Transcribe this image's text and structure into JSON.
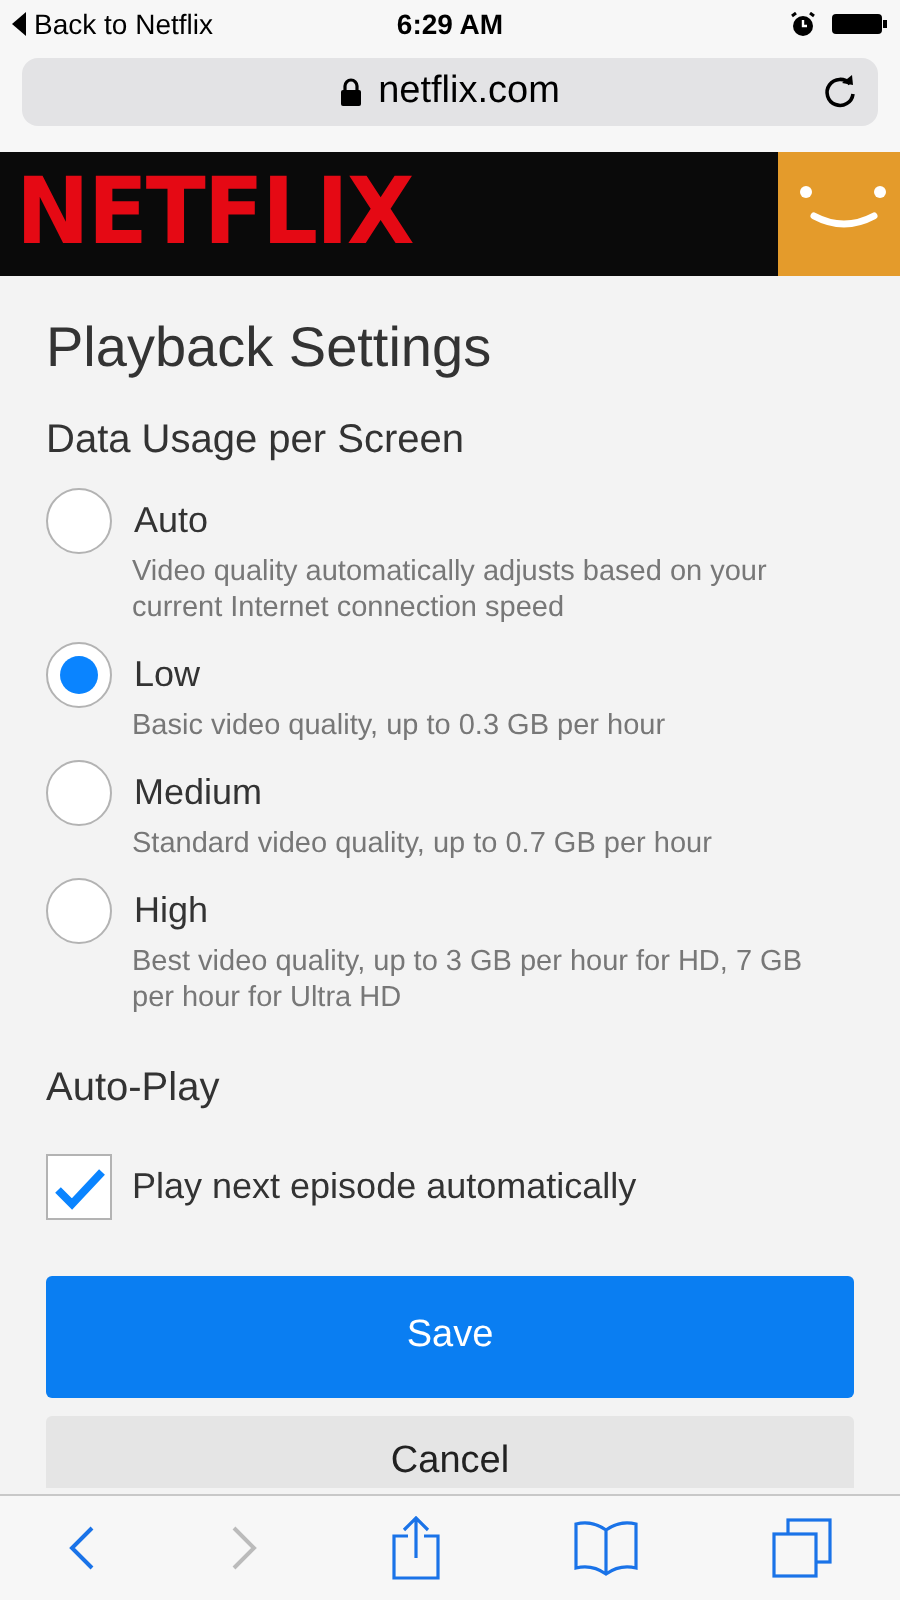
{
  "status_bar": {
    "back_label": "Back to Netflix",
    "time": "6:29 AM"
  },
  "address_bar": {
    "url": "netflix.com"
  },
  "banner": {
    "logo": "NETFLIX"
  },
  "title": "Playback Settings",
  "data_usage": {
    "heading": "Data Usage per Screen",
    "options": [
      {
        "label": "Auto",
        "description": "Video quality automatically adjusts based on your current Internet connection speed",
        "selected": false
      },
      {
        "label": "Low",
        "description": "Basic video quality, up to 0.3 GB per hour",
        "selected": true
      },
      {
        "label": "Medium",
        "description": "Standard video quality, up to 0.7 GB per hour",
        "selected": false
      },
      {
        "label": "High",
        "description": "Best video quality, up to 3 GB per hour for HD, 7 GB per hour for Ultra HD",
        "selected": false
      }
    ]
  },
  "autoplay": {
    "heading": "Auto-Play",
    "label": "Play next episode automatically",
    "checked": true
  },
  "buttons": [
    {
      "label": "Save",
      "kind": "primary"
    },
    {
      "label": "Cancel",
      "kind": "secondary"
    }
  ],
  "toolbar": {
    "back_disabled": false,
    "forward_disabled": true
  }
}
